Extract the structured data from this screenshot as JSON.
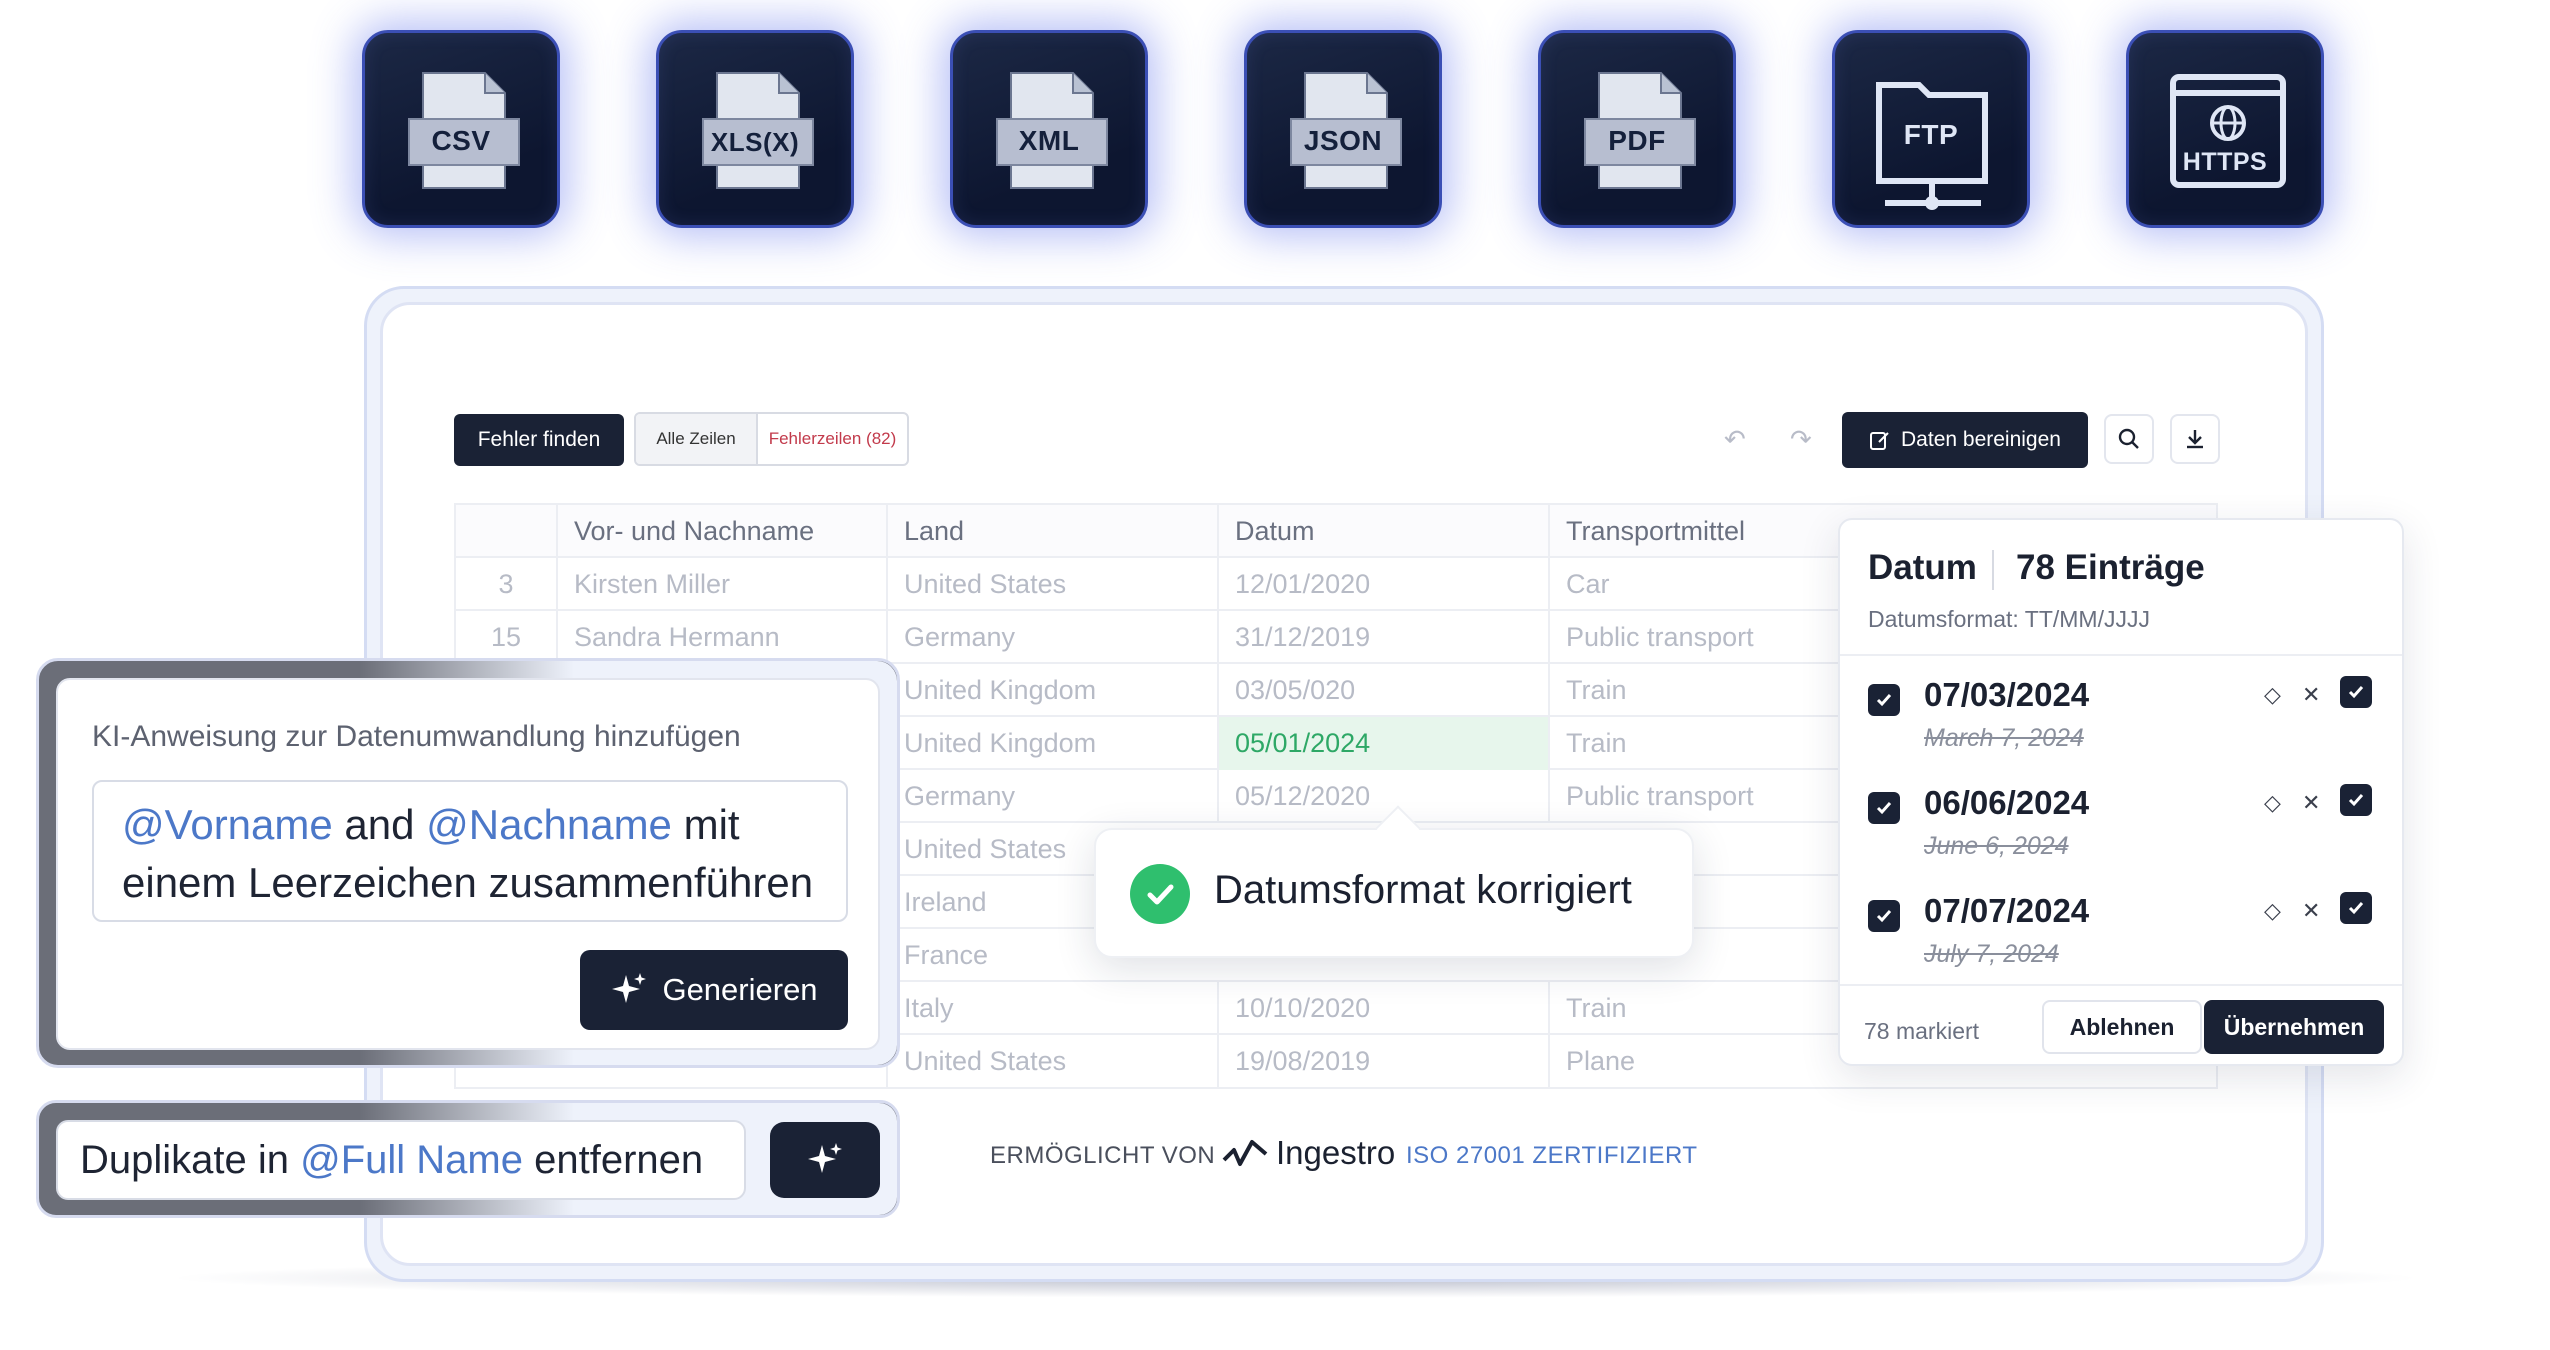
{
  "formats": [
    {
      "label": "CSV",
      "icon": "csv-file-icon"
    },
    {
      "label": "XLS(X)",
      "icon": "xls-file-icon"
    },
    {
      "label": "XML",
      "icon": "xml-file-icon"
    },
    {
      "label": "JSON",
      "icon": "json-file-icon"
    },
    {
      "label": "PDF",
      "icon": "pdf-file-icon"
    },
    {
      "label": "FTP",
      "icon": "ftp-folder-icon"
    },
    {
      "label": "HTTPS",
      "icon": "https-globe-icon"
    }
  ],
  "toolbar": {
    "find_errors": "Fehler finden",
    "all_rows": "Alle Zeilen",
    "error_rows": "Fehlerzeilen (82)",
    "clean_data": "Daten bereinigen"
  },
  "table": {
    "headers": [
      "",
      "Vor- und Nachname",
      "Land",
      "Datum",
      "Transportmittel"
    ],
    "rows": [
      [
        "3",
        "Kirsten Miller",
        "United States",
        "12/01/2020",
        "Car"
      ],
      [
        "15",
        "Sandra Hermann",
        "Germany",
        "31/12/2019",
        "Public transport"
      ],
      [
        "",
        "",
        "United Kingdom",
        "03/05/020",
        "Train"
      ],
      [
        "",
        "",
        "United Kingdom",
        "05/01/2024",
        "Train"
      ],
      [
        "",
        "",
        "Germany",
        "05/12/2020",
        "Public transport"
      ],
      [
        "",
        "",
        "United States",
        "",
        ""
      ],
      [
        "",
        "",
        "Ireland",
        "",
        ""
      ],
      [
        "",
        "",
        "France",
        "",
        ""
      ],
      [
        "",
        "",
        "Italy",
        "10/10/2020",
        "Train"
      ],
      [
        "",
        "",
        "United States",
        "19/08/2019",
        "Plane"
      ]
    ]
  },
  "ai_panel": {
    "title": "KI-Anweisung zur Datenumwandlung hinzufügen",
    "m1": "@Vorname",
    "t1": " and ",
    "m2": "@Nachname",
    "t2": " mit einem Leerzeichen zusammenführen",
    "generate": "Generieren"
  },
  "dedupe": {
    "t1": "Duplikate in ",
    "m1": "@Full Name",
    "t2": " entfernen"
  },
  "toast": {
    "text": "Datumsformat korrigiert"
  },
  "date_panel": {
    "title": "Datum",
    "count": "78 Einträge",
    "format": "Datumsformat: TT/MM/JJJJ",
    "items": [
      {
        "new": "07/03/2024",
        "old": "March 7, 2024"
      },
      {
        "new": "06/06/2024",
        "old": "June 6, 2024"
      },
      {
        "new": "07/07/2024",
        "old": "July 7, 2024"
      }
    ],
    "marked": "78 markiert",
    "reject": "Ablehnen",
    "apply": "Übernehmen"
  },
  "footer": {
    "powered_by": "ERMÖGLICHT VON",
    "brand": "Ingestro",
    "iso": "ISO 27001 ZERTIFIZIERT"
  },
  "colors": {
    "accent": "#4c78c8",
    "dark": "#1a2235",
    "success": "#2fbf6e",
    "error": "#c23a4b"
  }
}
